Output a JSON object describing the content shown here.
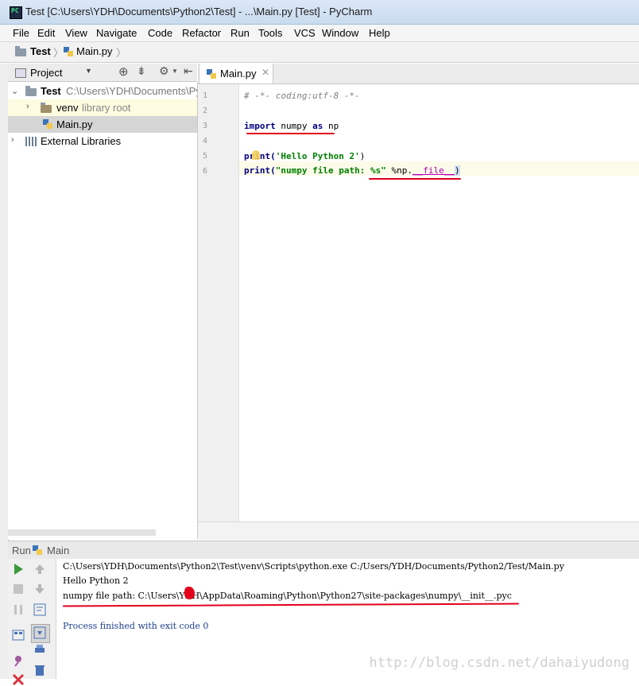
{
  "window": {
    "title": "Test [C:\\Users\\YDH\\Documents\\Python2\\Test] - ...\\Main.py [Test] - PyCharm"
  },
  "menu": [
    "File",
    "Edit",
    "View",
    "Navigate",
    "Code",
    "Refactor",
    "Run",
    "Tools",
    "VCS",
    "Window",
    "Help"
  ],
  "navbar": {
    "project": "Test",
    "file": "Main.py"
  },
  "project_panel": {
    "title": "Project",
    "root": {
      "name": "Test",
      "path": "C:\\Users\\YDH\\Documents\\Py"
    },
    "venv": {
      "name": "venv",
      "hint": "library root"
    },
    "file": "Main.py",
    "external": "External Libraries"
  },
  "editor": {
    "tab": "Main.py",
    "line_numbers": [
      "1",
      "2",
      "3",
      "4",
      "5",
      "6"
    ],
    "lines": {
      "l1": "# -*- coding:utf-8 -*-",
      "l3_kw1": "import",
      "l3_mod": " numpy ",
      "l3_kw2": "as",
      "l3_alias": " np",
      "l5_a": "print(",
      "l5_str": "'Hello Python 2'",
      "l5_b": ")",
      "l6_a": "print(",
      "l6_str": "\"numpy file path: %s\"",
      "l6_b": " %np.",
      "l6_attr": "__file__",
      "l6_c": ")"
    }
  },
  "run_panel": {
    "label": "Run",
    "config": "Main",
    "output": [
      "C:\\Users\\YDH\\Documents\\Python2\\Test\\venv\\Scripts\\python.exe C:/Users/YDH/Documents/Python2/Test/Main.py",
      "Hello Python 2",
      "numpy file path: C:\\Users\\YDH\\AppData\\Roaming\\Python\\Python27\\site-packages\\numpy\\__init__.pyc",
      "",
      "Process finished with exit code 0"
    ]
  },
  "watermark": "http://blog.csdn.net/dahaiyudong",
  "colors": {
    "keyword": "#000080",
    "string": "#008000",
    "annotation": "#e3001b",
    "run_green": "#3c9a3c"
  }
}
